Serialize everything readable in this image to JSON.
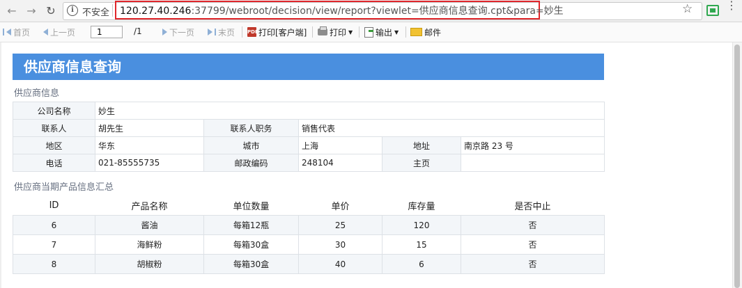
{
  "browser": {
    "security_label": "不安全",
    "url_host": "120.27.40.246",
    "url_rest": ":37799/webroot/decision/view/report?viewlet=供应商信息查询.cpt&para=妙生"
  },
  "toolbar": {
    "first_page": "首页",
    "prev_page": "上一页",
    "page_input_value": "1",
    "page_total": "/1",
    "next_page": "下一页",
    "last_page": "末页",
    "print_client": "打印[客户端]",
    "print": "打印",
    "export": "输出",
    "mail": "邮件"
  },
  "report": {
    "title": "供应商信息查询",
    "supplier_section": "供应商信息",
    "supplier": {
      "company_label": "公司名称",
      "company_value": "妙生",
      "contact_label": "联系人",
      "contact_value": "胡先生",
      "contact_title_label": "联系人职务",
      "contact_title_value": "销售代表",
      "region_label": "地区",
      "region_value": "华东",
      "city_label": "城市",
      "city_value": "上海",
      "address_label": "地址",
      "address_value": "南京路 23 号",
      "phone_label": "电话",
      "phone_value": "021-85555735",
      "postcode_label": "邮政编码",
      "postcode_value": "248104",
      "homepage_label": "主页",
      "homepage_value": ""
    },
    "products_section": "供应商当期产品信息汇总",
    "products": {
      "headers": [
        "ID",
        "产品名称",
        "单位数量",
        "单价",
        "库存量",
        "是否中止"
      ],
      "rows": [
        [
          "6",
          "酱油",
          "每箱12瓶",
          "25",
          "120",
          "否"
        ],
        [
          "7",
          "海鲜粉",
          "每箱30盒",
          "30",
          "15",
          "否"
        ],
        [
          "8",
          "胡椒粉",
          "每箱30盒",
          "40",
          "6",
          "否"
        ]
      ]
    }
  }
}
